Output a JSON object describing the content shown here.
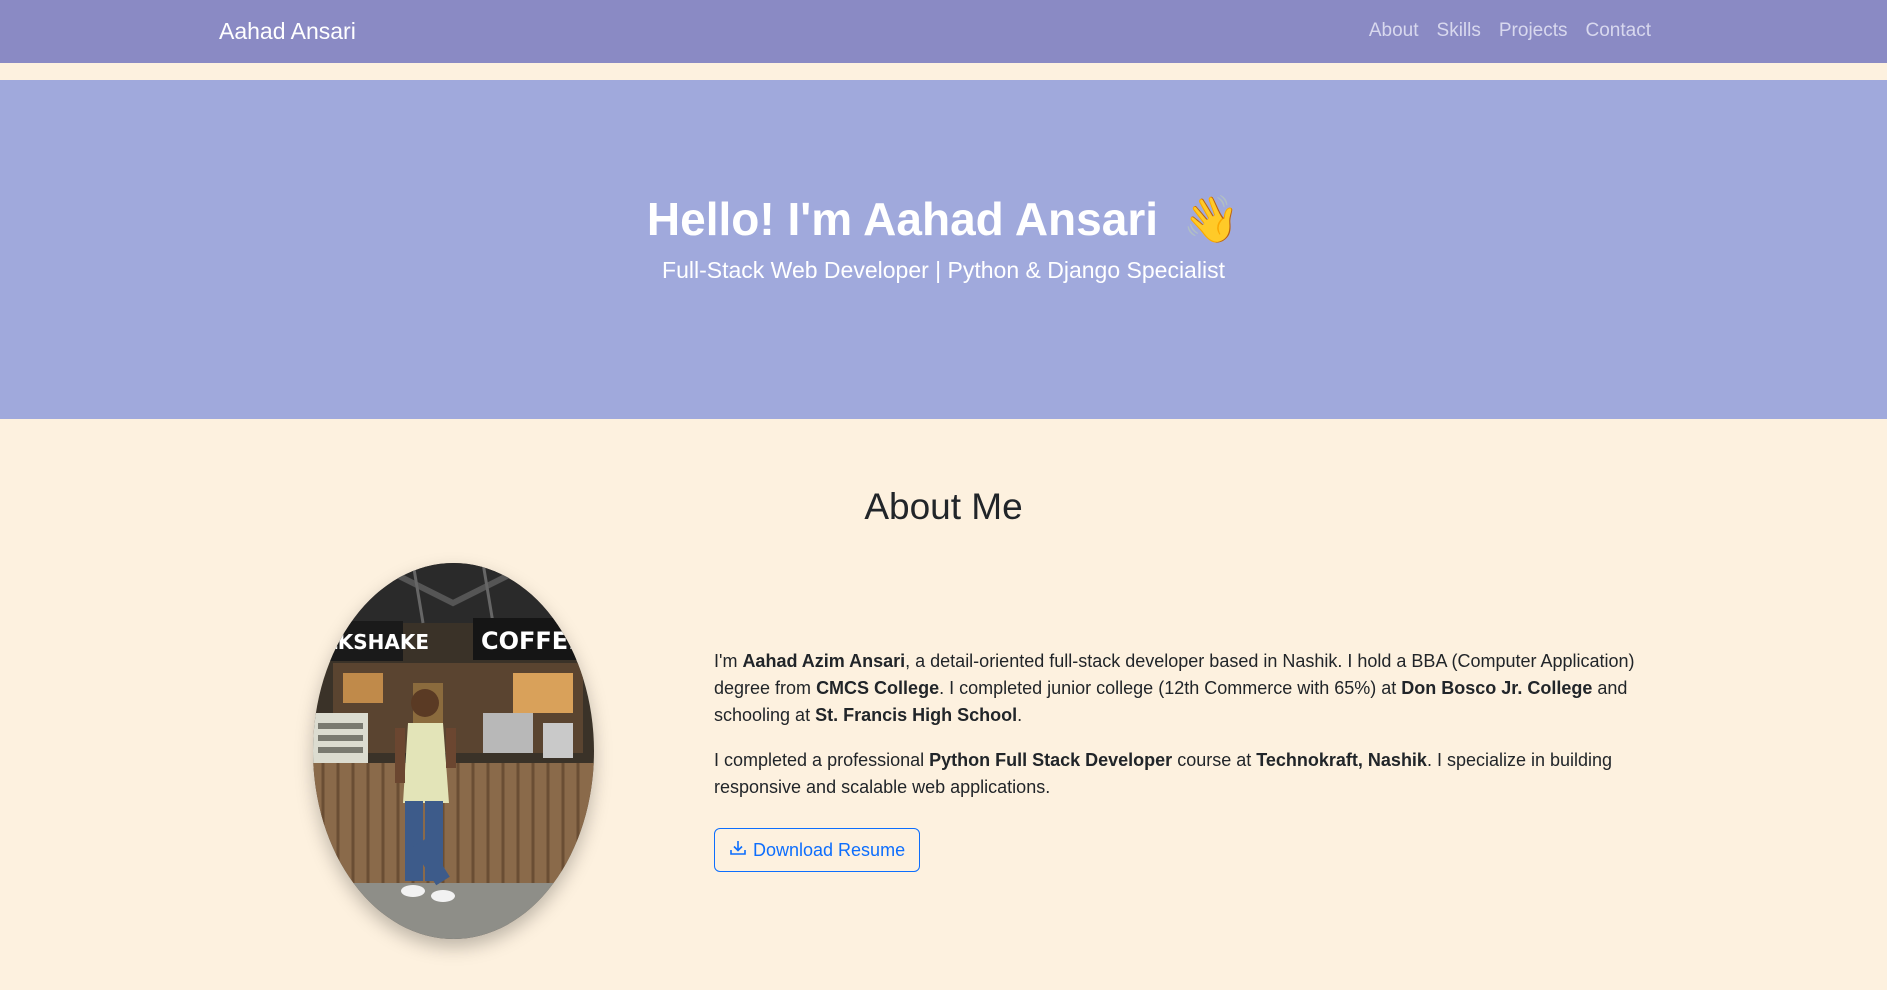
{
  "navbar": {
    "brand": "Aahad Ansari",
    "links": [
      "About",
      "Skills",
      "Projects",
      "Contact"
    ]
  },
  "hero": {
    "title": "Hello! I'm Aahad Ansari",
    "emoji": "👋",
    "subtitle": "Full-Stack Web Developer | Python & Django Specialist"
  },
  "about": {
    "heading": "About Me",
    "p1": {
      "t1": "I'm ",
      "name": "Aahad Azim Ansari",
      "t2": ", a detail-oriented full-stack developer based in Nashik. I hold a BBA (Computer Application) degree from ",
      "college": "CMCS College",
      "t3": ". I completed junior college (12th Commerce with 65%) at ",
      "junior": "Don Bosco Jr. College",
      "t4": " and schooling at ",
      "school": "St. Francis High School",
      "t5": "."
    },
    "p2": {
      "t1": "I completed a professional ",
      "course": "Python Full Stack Developer",
      "t2": " course at ",
      "institute": "Technokraft, Nashik",
      "t3": ". I specialize in building responsive and scalable web applications."
    },
    "resume_button": "Download Resume",
    "photo_alt_icon": "profile-photo"
  },
  "colors": {
    "navbar": "#8a8ac4",
    "hero": "#a0a9dc",
    "page_bg": "#fdf1df",
    "accent": "#0d6efd"
  }
}
